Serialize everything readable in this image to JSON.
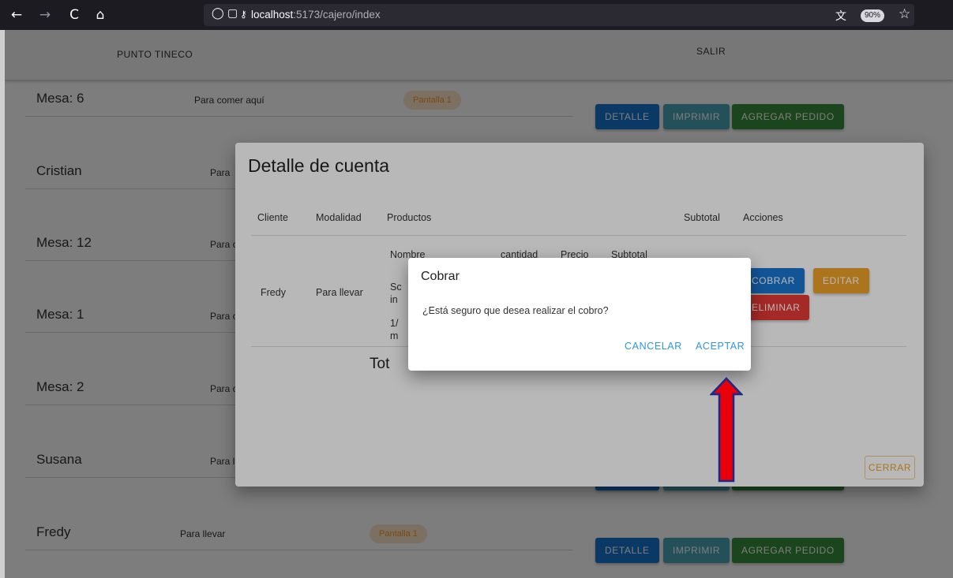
{
  "browser": {
    "back": "←",
    "forward": "→",
    "reload": "C",
    "home": "⌂",
    "url_host": "localhost",
    "url_rest": ":5173/cajero/index",
    "zoom": "90%"
  },
  "header": {
    "brand": "PUNTO TINECO",
    "logout": "SALIR"
  },
  "orders": [
    {
      "name": "Mesa: 6",
      "mode": "Para comer aquí",
      "chip": "Pantalla 1"
    },
    {
      "name": "Cristian",
      "mode": "Para",
      "chip": ""
    },
    {
      "name": "Mesa: 12",
      "mode": "Para c",
      "chip": ""
    },
    {
      "name": "Mesa: 1",
      "mode": "Para com",
      "chip": ""
    },
    {
      "name": "Mesa: 2",
      "mode": "Para com",
      "chip": ""
    },
    {
      "name": "Susana",
      "mode": "Para ll",
      "chip": ""
    },
    {
      "name": "Fredy",
      "mode": "Para llevar",
      "chip": "Pantalla 1"
    }
  ],
  "row_buttons": {
    "detail": "DETALLE",
    "print": "IMPRIMIR",
    "add": "AGREGAR PEDIDO"
  },
  "detail_dialog": {
    "title": "Detalle de cuenta",
    "headers": [
      "Cliente",
      "Modalidad",
      "Productos",
      "Subtotal",
      "Acciones"
    ],
    "product_headers": [
      "Nombre",
      "cantidad",
      "Precio",
      "Subtotal"
    ],
    "client": "Fredy",
    "mode": "Para llevar",
    "product_frag_1": "Sc",
    "product_frag_1b": "in",
    "product_frag_2": "1/",
    "product_frag_2b": "m",
    "total_visible": "Tot",
    "actions": {
      "cobrar": "COBRAR",
      "editar": "EDITAR",
      "eliminar": "ELIMINAR"
    },
    "close": "CERRAR"
  },
  "confirm_dialog": {
    "title": "Cobrar",
    "message": "¿Está seguro que desea realizar el cobro?",
    "cancel": "CANCELAR",
    "accept": "ACEPTAR"
  },
  "colors": {
    "primary": "#1976d2",
    "teal": "#4aa6b7",
    "green": "#388e3c",
    "orange": "#f0a12a",
    "red": "#e53935",
    "arrow": "#e8000a"
  }
}
